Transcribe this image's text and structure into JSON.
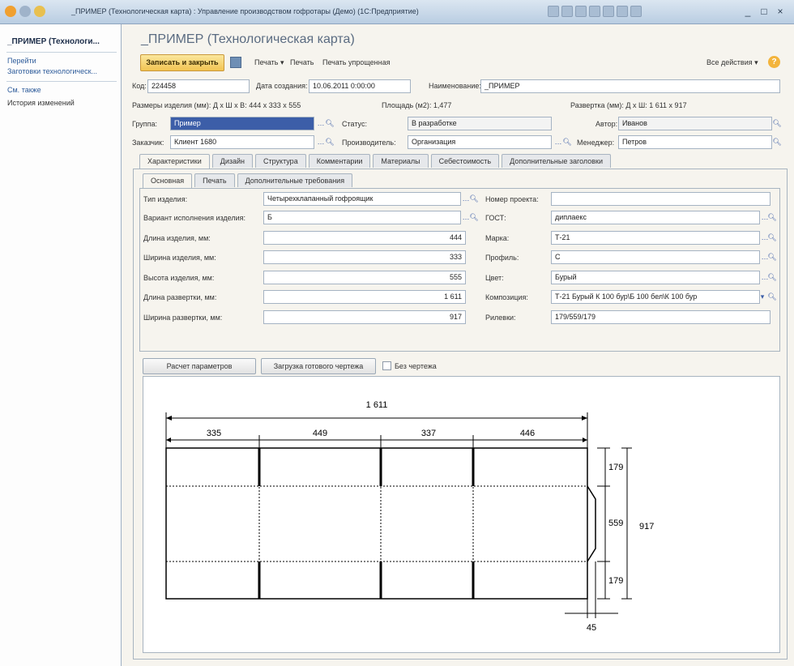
{
  "window": {
    "title": "_ПРИМЕР (Технологическая карта) : Управление производством гофротары (Демо) (1С:Предприятие)",
    "controls": [
      "_",
      "□",
      "×"
    ]
  },
  "sidebar": {
    "title": "_ПРИМЕР (Технологи...",
    "goto_label": "Перейти",
    "goto_item": "Заготовки технологическ...",
    "see_also_label": "См. также",
    "see_also_item": "История изменений"
  },
  "form": {
    "title": "_ПРИМЕР (Технологическая карта)",
    "toolbar": {
      "save_close": "Записать и закрыть",
      "print": "Печать ▾",
      "print2": "Печать",
      "print_simple": "Печать упрощенная",
      "all_actions": "Все действия ▾"
    },
    "code_label": "Код:",
    "code_value": "224458",
    "date_label": "Дата создания:",
    "date_value": "10.06.2011 0:00:00",
    "name_label": "Наименование:",
    "name_value": "_ПРИМЕР",
    "sizes_text": "Размеры изделия (мм): Д x Ш x В: 444 x 333 x 555",
    "area_text": "Площадь (м2): 1,477",
    "unfold_text": "Развертка (мм): Д x Ш: 1 611 x 917",
    "group_label": "Группа:",
    "group_value": "Пример",
    "status_label": "Статус:",
    "status_value": "В разработке",
    "author_label": "Автор:",
    "author_value": "Иванов",
    "customer_label": "Заказчик:",
    "customer_value": "Клиент 1680",
    "producer_label": "Производитель:",
    "producer_value": "Организация",
    "manager_label": "Менеджер:",
    "manager_value": "Петров"
  },
  "tabs": [
    "Характеристики",
    "Дизайн",
    "Структура",
    "Комментарии",
    "Материалы",
    "Себестоимость",
    "Дополнительные заголовки"
  ],
  "subtabs": [
    "Основная",
    "Печать",
    "Дополнительные требования"
  ],
  "fields_left": [
    {
      "label": "Тип изделия:",
      "value": "Четырехклапанный гофроящик",
      "align": "left"
    },
    {
      "label": "Вариант исполнения изделия:",
      "value": "Б",
      "align": "left"
    },
    {
      "label": "Длина изделия, мм:",
      "value": "444",
      "align": "right"
    },
    {
      "label": "Ширина изделия, мм:",
      "value": "333",
      "align": "right"
    },
    {
      "label": "Высота изделия, мм:",
      "value": "555",
      "align": "right"
    },
    {
      "label": "Длина развертки, мм:",
      "value": "1 611",
      "align": "right"
    },
    {
      "label": "Ширина развертки, мм:",
      "value": "917",
      "align": "right"
    }
  ],
  "fields_right": [
    {
      "label": "Номер проекта:",
      "value": ""
    },
    {
      "label": "ГОСТ:",
      "value": "диплаекс"
    },
    {
      "label": "Марка:",
      "value": "Т-21"
    },
    {
      "label": "Профиль:",
      "value": "С"
    },
    {
      "label": "Цвет:",
      "value": "Бурый"
    },
    {
      "label": "Композиция:",
      "value": "Т-21 Бурый К 100 бур\\Б 100 бел\\К 100 бур"
    },
    {
      "label": "Рилевки:",
      "value": "179/559/179"
    }
  ],
  "buttons": {
    "calc": "Расчет параметров",
    "load": "Загрузка готового чертежа",
    "no_drawing": "Без чертежа"
  },
  "drawing": {
    "total_length": "1 611",
    "segments": [
      "335",
      "449",
      "337",
      "446"
    ],
    "right_dims": [
      "179",
      "559",
      "179"
    ],
    "total_width": "917",
    "flap": "45"
  }
}
